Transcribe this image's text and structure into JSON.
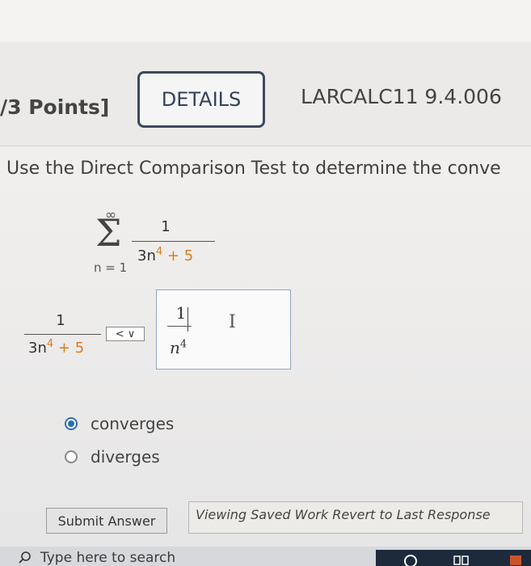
{
  "header": {
    "points": "/3 Points]",
    "details_button": "DETAILS",
    "problem_code": "LARCALC11 9.4.006"
  },
  "question": {
    "text": "Use the Direct Comparison Test to determine the conve"
  },
  "series": {
    "upper_limit": "∞",
    "lower_limit": "n = 1",
    "numerator": "1",
    "denominator_coef": "3n",
    "denominator_exp": "4",
    "denominator_rest": "+ 5"
  },
  "comparison": {
    "left_numerator": "1",
    "left_den_coef": "3n",
    "left_den_exp": "4",
    "left_den_rest": "+ 5",
    "selector_value": "< ∨",
    "answer_numerator": "1",
    "answer_den_base": "n",
    "answer_den_exp": "4"
  },
  "options": [
    {
      "label": "converges",
      "selected": true
    },
    {
      "label": "diverges",
      "selected": false
    }
  ],
  "footer": {
    "submit_button": "Submit Answer",
    "saved_text": "Viewing Saved Work Revert to Last Response"
  },
  "taskbar": {
    "search_placeholder": "Type here to search"
  }
}
